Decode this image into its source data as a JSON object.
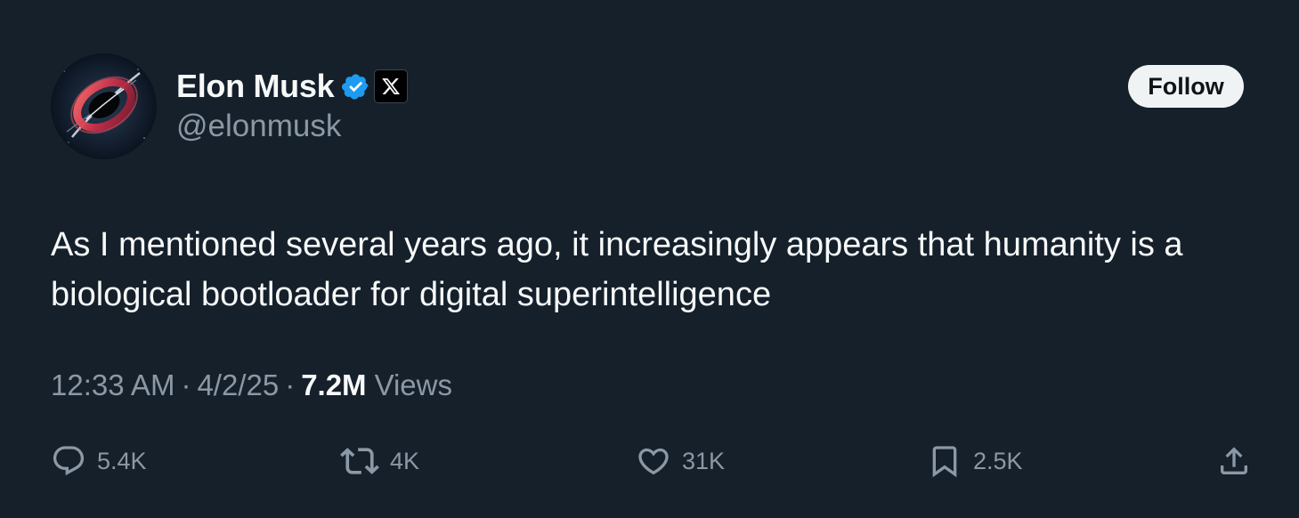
{
  "author": {
    "display_name": "Elon Musk",
    "handle": "@elonmusk",
    "avatar_icon": "black-hole-avatar-icon",
    "verified_icon": "verified-badge-icon",
    "affiliation_icon": "x-logo-icon"
  },
  "follow_button": {
    "label": "Follow"
  },
  "tweet": {
    "text": "As I mentioned several years ago, it increasingly appears that humanity is a biological bootloader for digital superintelligence"
  },
  "meta": {
    "time": "12:33 AM",
    "separator": "·",
    "date": "4/2/25",
    "views_count": "7.2M",
    "views_label": "Views"
  },
  "actions": {
    "reply": {
      "icon": "reply-icon",
      "count": "5.4K"
    },
    "retweet": {
      "icon": "retweet-icon",
      "count": "4K"
    },
    "like": {
      "icon": "heart-icon",
      "count": "31K"
    },
    "bookmark": {
      "icon": "bookmark-icon",
      "count": "2.5K"
    },
    "share": {
      "icon": "share-icon"
    }
  },
  "colors": {
    "background": "#15202b",
    "primary_text": "#f7f9f9",
    "secondary_text": "#8b98a5",
    "verified_blue": "#1d9bf0",
    "follow_button_bg": "#eff3f4"
  }
}
